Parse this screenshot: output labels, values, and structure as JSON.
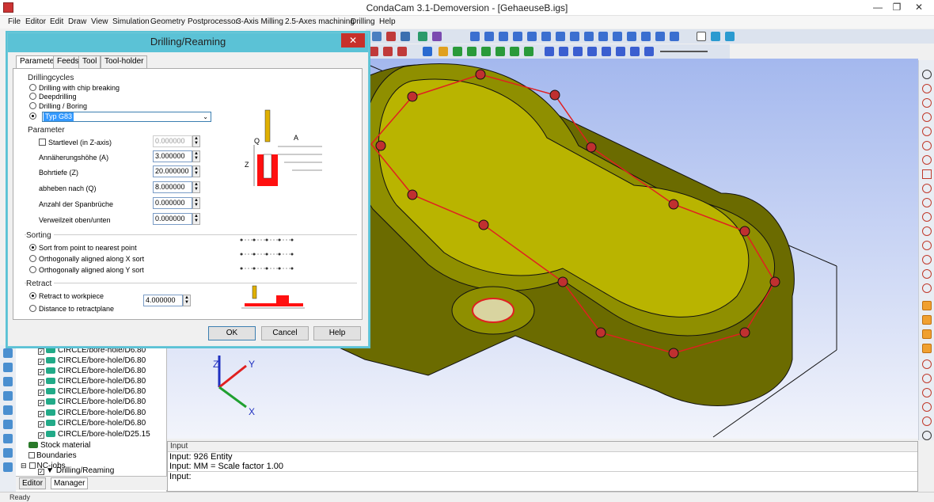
{
  "window": {
    "title": "CondaCam 3.1-Demoversion - [GehaeuseB.igs]",
    "minimize": "—",
    "maximize": "❐",
    "close": "✕"
  },
  "menu": [
    "File",
    "Editor",
    "Edit",
    "Draw",
    "View",
    "Simulation",
    "Geometry",
    "Postprocessor",
    "3-Axis Milling",
    "2.5-Axes machining",
    "Drilling",
    "Help"
  ],
  "dialog": {
    "title": "Drilling/Reaming",
    "close": "✕",
    "tabs": [
      "Parameter",
      "Feeds",
      "Tool",
      "Tool-holder"
    ],
    "drillingcycles": {
      "label": "Drillingcycles",
      "options": [
        "Drilling with chip breaking",
        "Deepdrilling",
        "Drilling / Boring"
      ],
      "select_value": "Typ G83"
    },
    "parameter": {
      "label": "Parameter",
      "startlevel_label": "Startlevel (in Z-axis)",
      "fields": [
        {
          "label": "Startlevel (in Z-axis)",
          "value": "0.000000"
        },
        {
          "label": "Annäherungshöhe (A)",
          "value": "3.000000"
        },
        {
          "label": "Bohrtiefe (Z)",
          "value": "20.000000"
        },
        {
          "label": "abheben nach (Q)",
          "value": "8.000000"
        },
        {
          "label": "Anzahl der Spanbrüche",
          "value": "0.000000"
        },
        {
          "label": "Verweilzeit oben/unten",
          "value": "0.000000"
        }
      ],
      "diagram_labels": {
        "q": "Q",
        "a": "A",
        "z": "Z"
      }
    },
    "sorting": {
      "label": "Sorting",
      "options": [
        "Sort from point to nearest point",
        "Orthogonally aligned along X sort",
        "Orthogonally aligned along Y sort"
      ]
    },
    "retract": {
      "label": "Retract",
      "options": [
        "Retract to workpiece",
        "Distance to retractplane"
      ],
      "value": "4.000000"
    },
    "buttons": {
      "ok": "OK",
      "cancel": "Cancel",
      "help": "Help"
    }
  },
  "tree": {
    "items": [
      "CIRCLE/bore-hole/D6.80",
      "CIRCLE/bore-hole/D6.80",
      "CIRCLE/bore-hole/D6.80",
      "CIRCLE/bore-hole/D6.80",
      "CIRCLE/bore-hole/D6.80",
      "CIRCLE/bore-hole/D6.80",
      "CIRCLE/bore-hole/D6.80",
      "CIRCLE/bore-hole/D6.80",
      "CIRCLE/bore-hole/D25.15"
    ],
    "stock": "Stock material",
    "boundaries": "Boundaries",
    "ncjobs": "NC-jobs",
    "drilling": "Drilling/Reaming",
    "tabs": [
      "Editor",
      "Manager"
    ]
  },
  "axes": {
    "x": "X",
    "y": "Y",
    "z": "Z"
  },
  "input": {
    "header": "Input",
    "lines": [
      "Input: 926 Entity",
      "Input: MM = Scale factor 1.00",
      "Input:"
    ]
  },
  "status": "Ready",
  "colors": {
    "part": "#8a8a00",
    "toolpath": "#e02020",
    "dialog_border": "#5bc2d6",
    "select": "#3399ff"
  }
}
